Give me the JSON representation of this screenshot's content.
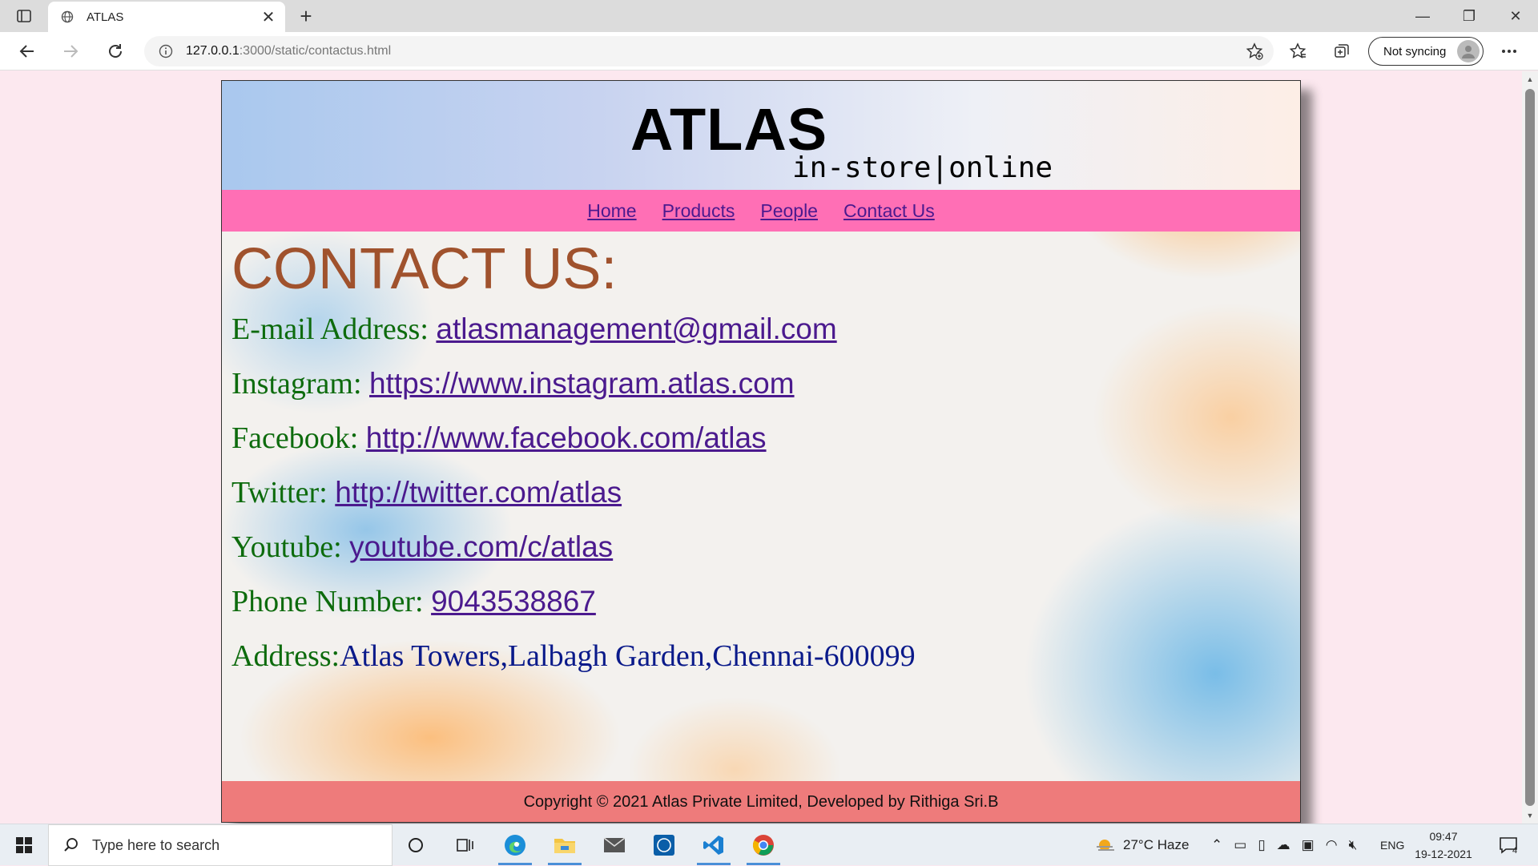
{
  "browser": {
    "tab_title": "ATLAS",
    "url_host": "127.0.0.1",
    "url_rest": ":3000/static/contactus.html",
    "sync_label": "Not syncing"
  },
  "site": {
    "brand": "ATLAS",
    "tagline": "in-store|online",
    "nav": [
      "Home",
      "Products",
      "People",
      "Contact Us"
    ],
    "page_title": "CONTACT US:",
    "contacts": [
      {
        "label": "E-mail Address: ",
        "value": "atlasmanagement@gmail.com"
      },
      {
        "label": "Instagram: ",
        "value": "https://www.instagram.atlas.com"
      },
      {
        "label": "Facebook: ",
        "value": "http://www.facebook.com/atlas"
      },
      {
        "label": "Twitter: ",
        "value": "http://twitter.com/atlas"
      },
      {
        "label": "Youtube: ",
        "value": "youtube.com/c/atlas"
      },
      {
        "label": "Phone Number: ",
        "value": "9043538867"
      }
    ],
    "address": {
      "label": "Address:",
      "value": "Atlas Towers,Lalbagh Garden,Chennai-600099"
    },
    "footer": "Copyright © 2021 Atlas Private Limited, Developed by Rithiga Sri.B"
  },
  "taskbar": {
    "search_placeholder": "Type here to search",
    "weather": "27°C  Haze",
    "language": "ENG",
    "time": "09:47",
    "date": "19-12-2021",
    "notification_count": "4"
  },
  "colors": {
    "nav_bg": "#ff6fb5",
    "footer_bg": "#ee7b7b",
    "title": "#a0522d",
    "label": "#0d6b0d",
    "link": "#4b1a8e"
  }
}
